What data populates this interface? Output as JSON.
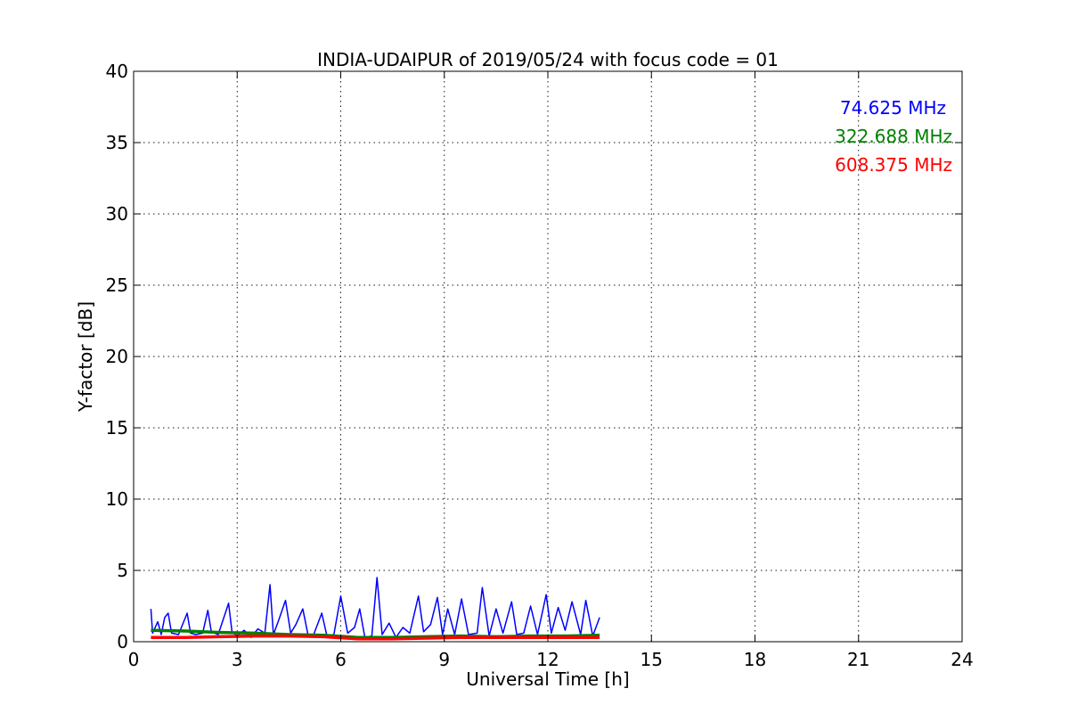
{
  "chart_data": {
    "type": "line",
    "title": "INDIA-UDAIPUR of 2019/05/24 with focus code = 01",
    "xlabel": "Universal Time [h]",
    "ylabel": "Y-factor [dB]",
    "xlim": [
      0,
      24
    ],
    "ylim": [
      0,
      40
    ],
    "xticks": [
      0,
      3,
      6,
      9,
      12,
      15,
      18,
      21,
      24
    ],
    "yticks": [
      0,
      5,
      10,
      15,
      20,
      25,
      30,
      35,
      40
    ],
    "grid": true,
    "legend_position": "top-right",
    "series": [
      {
        "name": "74.625 MHz",
        "color": "#0000ff",
        "x": [
          0.5,
          0.55,
          0.7,
          0.8,
          0.9,
          1.0,
          1.1,
          1.3,
          1.55,
          1.65,
          1.8,
          2.0,
          2.15,
          2.25,
          2.45,
          2.6,
          2.75,
          2.85,
          3.0,
          3.2,
          3.4,
          3.6,
          3.8,
          3.95,
          4.05,
          4.2,
          4.4,
          4.55,
          4.7,
          4.9,
          5.05,
          5.2,
          5.45,
          5.6,
          5.8,
          6.0,
          6.2,
          6.4,
          6.55,
          6.7,
          6.9,
          7.05,
          7.2,
          7.4,
          7.6,
          7.8,
          8.0,
          8.25,
          8.4,
          8.6,
          8.8,
          8.95,
          9.1,
          9.3,
          9.5,
          9.7,
          9.95,
          10.1,
          10.3,
          10.5,
          10.7,
          10.95,
          11.1,
          11.3,
          11.5,
          11.7,
          11.95,
          12.1,
          12.3,
          12.5,
          12.7,
          12.95,
          13.1,
          13.3,
          13.5
        ],
        "y": [
          2.3,
          0.6,
          1.4,
          0.5,
          1.7,
          2.0,
          0.6,
          0.5,
          2.0,
          0.6,
          0.5,
          0.6,
          2.2,
          0.7,
          0.5,
          1.6,
          2.7,
          0.7,
          0.4,
          0.8,
          0.3,
          0.9,
          0.6,
          4.0,
          0.5,
          1.5,
          2.9,
          0.6,
          1.2,
          2.3,
          0.5,
          0.4,
          2.0,
          0.4,
          0.5,
          3.2,
          0.6,
          1.0,
          2.3,
          0.3,
          0.4,
          4.5,
          0.5,
          1.3,
          0.3,
          1.0,
          0.6,
          3.2,
          0.7,
          1.2,
          3.1,
          0.5,
          2.3,
          0.5,
          3.0,
          0.5,
          0.6,
          3.8,
          0.4,
          2.3,
          0.6,
          2.8,
          0.5,
          0.6,
          2.5,
          0.5,
          3.3,
          0.6,
          2.4,
          0.8,
          2.8,
          0.5,
          2.9,
          0.4,
          1.7
        ]
      },
      {
        "name": "322.688 MHz",
        "color": "#008000",
        "x": [
          0.5,
          1.5,
          2.5,
          3.5,
          4.5,
          5.5,
          6.5,
          7.5,
          8.5,
          9.5,
          10.5,
          11.5,
          12.5,
          13.5
        ],
        "y": [
          0.8,
          0.75,
          0.65,
          0.6,
          0.5,
          0.45,
          0.3,
          0.3,
          0.35,
          0.4,
          0.35,
          0.4,
          0.4,
          0.45
        ]
      },
      {
        "name": "608.375 MHz",
        "color": "#ff0000",
        "x": [
          0.5,
          1.5,
          2.5,
          3.5,
          4.5,
          5.5,
          6.5,
          7.5,
          8.5,
          9.5,
          10.5,
          11.5,
          12.5,
          13.5
        ],
        "y": [
          0.3,
          0.3,
          0.35,
          0.4,
          0.4,
          0.35,
          0.2,
          0.2,
          0.25,
          0.3,
          0.3,
          0.3,
          0.3,
          0.3
        ]
      }
    ]
  }
}
